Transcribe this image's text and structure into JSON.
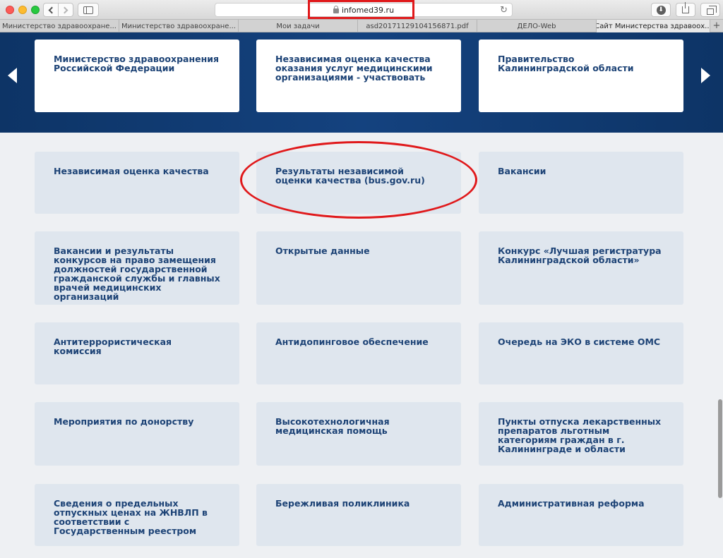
{
  "browser": {
    "url": "infomed39.ru",
    "tabs": [
      "Министерство здравоохране...",
      "Министерство здравоохране...",
      "Мои задачи",
      "asd20171129104156871.pdf",
      "ДЕЛО-Web",
      "Сайт Министерства здравоох..."
    ],
    "new_tab": "+",
    "reload": "↻"
  },
  "hero": {
    "cards": [
      "Министерство здравоохранения Российской Федерации",
      "Независимая оценка качества оказания услуг медицинскими организациями - участвовать",
      "Правительство Калининградской области"
    ]
  },
  "grid": {
    "cards": [
      "Независимая оценка качества",
      "Результаты независимой оценки качества (bus.gov.ru)",
      "Вакансии",
      "Вакансии и результаты конкурсов на право замещения должностей государственной гражданской службы и главных врачей медицинских организаций",
      "Открытые данные",
      "Конкурс «Лучшая регистратура Калининградской области»",
      "Антитеррористическая комиссия",
      "Антидопинговое обеспечение",
      "Очередь на ЭКО в системе ОМС",
      "Мероприятия по донорству",
      "Высокотехнологичная медицинская помощь",
      "Пункты отпуска лекарственных препаратов льготным категориям граждан в г. Калининграде и области",
      "Сведения о предельных отпускных ценах на ЖНВЛП в соответствии с Государственным реестром",
      "Бережливая поликлиника",
      "Административная реформа"
    ]
  },
  "colors": {
    "hero_bg": "#14427f",
    "card_text": "#1d4376",
    "card_bg": "#dfe6ee",
    "annotation": "#e0191b"
  }
}
